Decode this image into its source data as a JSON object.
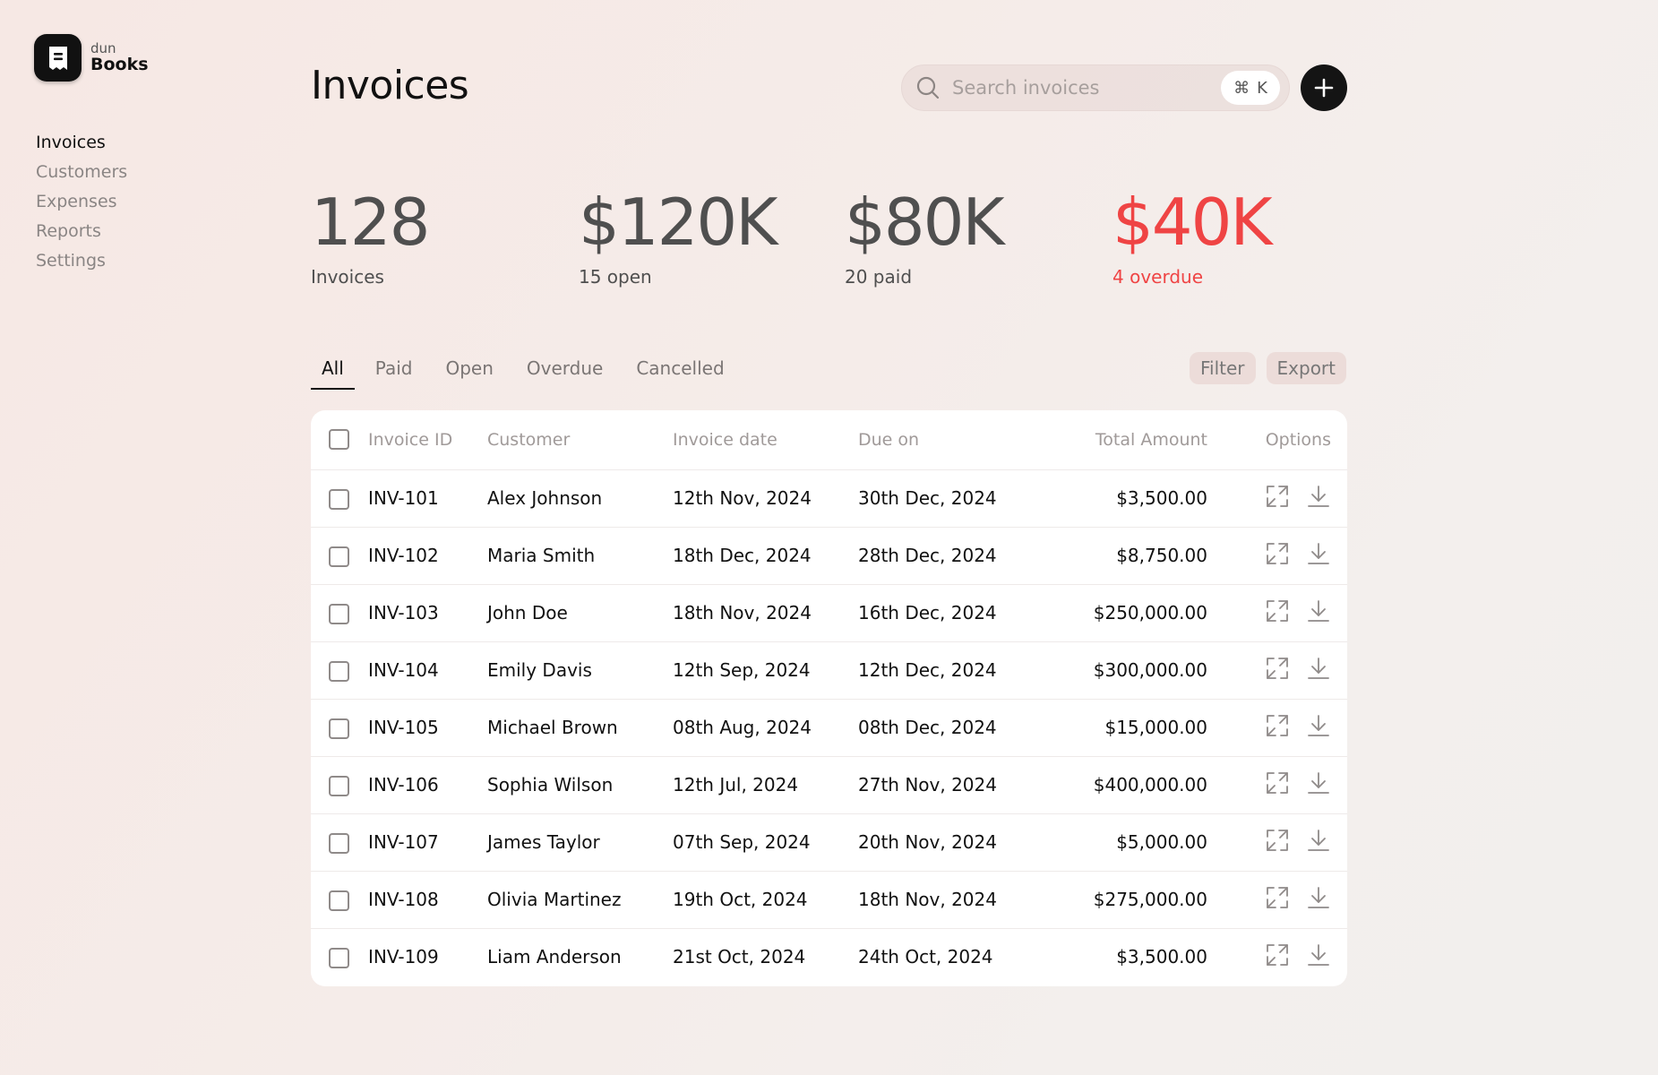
{
  "brand": {
    "small": "dun",
    "name": "Books"
  },
  "nav": [
    "Invoices",
    "Customers",
    "Expenses",
    "Reports",
    "Settings"
  ],
  "header": {
    "title": "Invoices",
    "search_placeholder": "Search invoices",
    "shortcut_symbol": "⌘",
    "shortcut_key": "K"
  },
  "stats": [
    {
      "value": "128",
      "label": "Invoices"
    },
    {
      "value": "$120K",
      "label": "15 open"
    },
    {
      "value": "$80K",
      "label": "20 paid"
    },
    {
      "value": "$40K",
      "label": "4 overdue"
    }
  ],
  "tabs": [
    "All",
    "Paid",
    "Open",
    "Overdue",
    "Cancelled"
  ],
  "actions": {
    "filter": "Filter",
    "export": "Export"
  },
  "table": {
    "columns": [
      "Invoice ID",
      "Customer",
      "Invoice date",
      "Due on",
      "Total Amount",
      "Options"
    ],
    "rows": [
      {
        "id": "INV-101",
        "customer": "Alex Johnson",
        "date": "12th Nov, 2024",
        "due": "30th Dec, 2024",
        "total": "$3,500.00"
      },
      {
        "id": "INV-102",
        "customer": "Maria Smith",
        "date": "18th Dec, 2024",
        "due": "28th Dec, 2024",
        "total": "$8,750.00"
      },
      {
        "id": "INV-103",
        "customer": "John Doe",
        "date": "18th Nov, 2024",
        "due": "16th Dec, 2024",
        "total": "$250,000.00"
      },
      {
        "id": "INV-104",
        "customer": "Emily Davis",
        "date": "12th Sep, 2024",
        "due": "12th Dec, 2024",
        "total": "$300,000.00"
      },
      {
        "id": "INV-105",
        "customer": "Michael Brown",
        "date": "08th Aug, 2024",
        "due": "08th Dec, 2024",
        "total": "$15,000.00"
      },
      {
        "id": "INV-106",
        "customer": "Sophia Wilson",
        "date": "12th Jul, 2024",
        "due": "27th Nov, 2024",
        "total": "$400,000.00"
      },
      {
        "id": "INV-107",
        "customer": "James Taylor",
        "date": "07th Sep, 2024",
        "due": "20th Nov, 2024",
        "total": "$5,000.00"
      },
      {
        "id": "INV-108",
        "customer": "Olivia Martinez",
        "date": "19th Oct, 2024",
        "due": "18th Nov, 2024",
        "total": "$275,000.00"
      },
      {
        "id": "INV-109",
        "customer": "Liam Anderson",
        "date": "21st Oct, 2024",
        "due": "24th Oct, 2024",
        "total": "$3,500.00"
      }
    ]
  },
  "colors": {
    "overdue": "#ef4444",
    "accent": "#141414"
  },
  "icons": {
    "logo": "receipt-icon",
    "search": "search-icon",
    "add": "plus-icon",
    "expand": "expand-icon",
    "download": "download-icon"
  }
}
